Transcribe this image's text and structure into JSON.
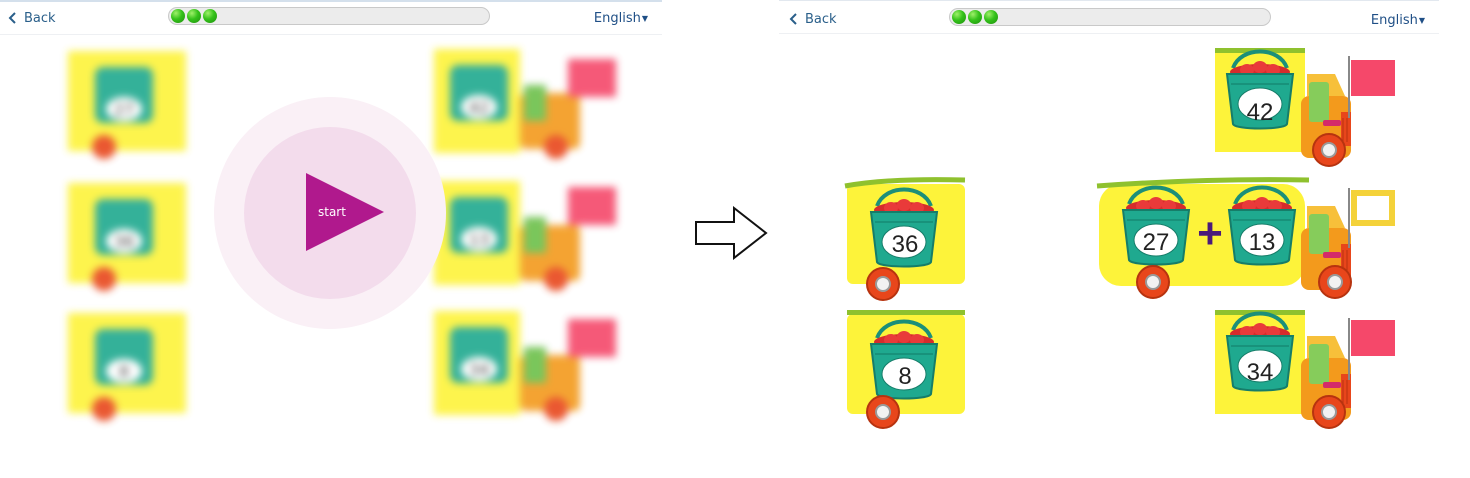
{
  "header": {
    "back_label": "Back",
    "language_label": "English",
    "progress_dots": 3
  },
  "start": {
    "label": "start"
  },
  "left_scene": {
    "basket_numbers": [
      "27",
      "42",
      "36",
      "13",
      "8",
      "34"
    ]
  },
  "right_scene": {
    "top_right": "42",
    "mid_left": "36",
    "mid_center_a": "27",
    "mid_center_op": "+",
    "mid_center_b": "13",
    "bottom_left": "8",
    "bottom_right": "34"
  },
  "colors": {
    "truck_yellow": "#fdf33a",
    "truck_orange": "#f39a1c",
    "basket_teal": "#1fa98f",
    "flag_red": "#f5486a",
    "start_purple": "#b0198d",
    "progress_green": "#34c21a"
  }
}
